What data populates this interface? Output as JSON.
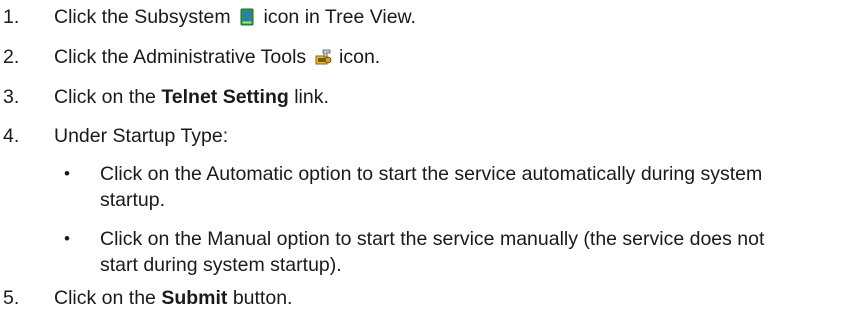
{
  "steps": [
    {
      "number": "1.",
      "before_icon": "Click the Subsystem",
      "icon": "subsystem-icon",
      "after_icon": "icon in Tree View."
    },
    {
      "number": "2.",
      "before_icon": "Click the Administrative Tools",
      "icon": "administrative-tools-icon",
      "after_icon": "icon."
    },
    {
      "number": "3.",
      "before_bold": "Click on the",
      "bold": "Telnet Setting",
      "after_bold": "link."
    },
    {
      "number": "4.",
      "text": "Under Startup Type:",
      "bullets": [
        "Click on the Automatic option to start the service automatically during system startup.",
        "Click on the Manual option to start the service manually (the service does not start during system startup)."
      ]
    },
    {
      "number": "5.",
      "before_bold": "Click on the",
      "bold": "Submit",
      "after_bold": "button."
    }
  ],
  "bullet_glyph": "•",
  "colors": {
    "text": "#1a1a1a",
    "subsystem_icon_primary": "#2a9d3c",
    "subsystem_icon_accent": "#2f6fd6",
    "admin_tools_icon_primary": "#d4a020"
  }
}
